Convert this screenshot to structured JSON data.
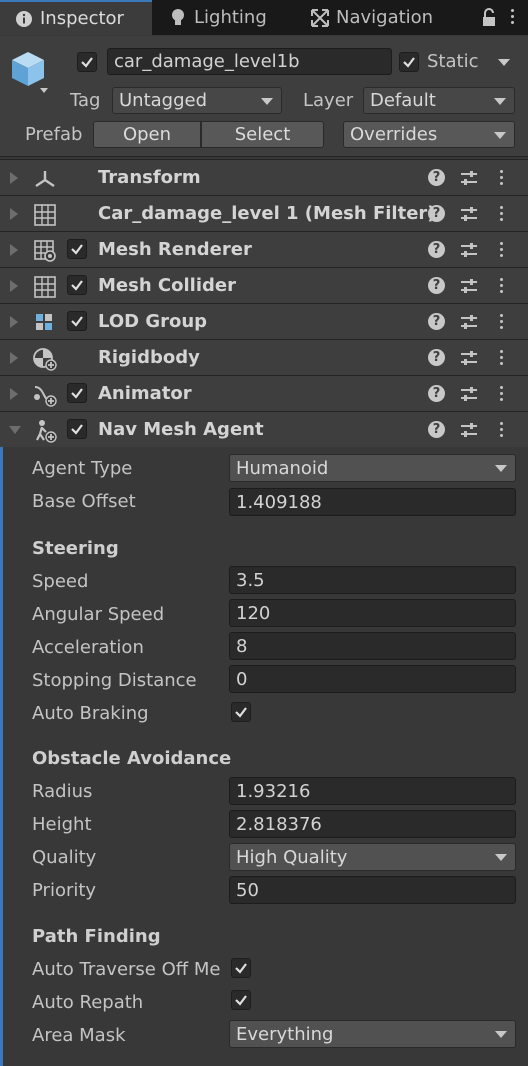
{
  "tabs": [
    {
      "label": "Inspector",
      "icon": "info-icon"
    },
    {
      "label": "Lighting",
      "icon": "bulb-icon"
    },
    {
      "label": "Navigation",
      "icon": "navigation-icon"
    }
  ],
  "header": {
    "object_name": "car_damage_level1b",
    "active": true,
    "static_label": "Static",
    "static_checked": true,
    "tag_label": "Tag",
    "tag_value": "Untagged",
    "layer_label": "Layer",
    "layer_value": "Default",
    "prefab_label": "Prefab",
    "open_label": "Open",
    "select_label": "Select",
    "overrides_label": "Overrides"
  },
  "components": [
    {
      "title": "Transform",
      "has_toggle": false,
      "icon": "transform-icon"
    },
    {
      "title": "Car_damage_level 1 (Mesh Filter)",
      "has_toggle": false,
      "icon": "mesh-filter-icon"
    },
    {
      "title": "Mesh Renderer",
      "has_toggle": true,
      "icon": "mesh-renderer-icon"
    },
    {
      "title": "Mesh Collider",
      "has_toggle": true,
      "icon": "mesh-collider-icon"
    },
    {
      "title": "LOD Group",
      "has_toggle": true,
      "icon": "lod-group-icon"
    },
    {
      "title": "Rigidbody",
      "has_toggle": false,
      "icon": "rigidbody-icon"
    },
    {
      "title": "Animator",
      "has_toggle": true,
      "icon": "animator-icon"
    },
    {
      "title": "Nav Mesh Agent",
      "has_toggle": true,
      "icon": "nav-mesh-agent-icon",
      "expanded": true
    }
  ],
  "nav_agent": {
    "agent_type_label": "Agent Type",
    "agent_type_value": "Humanoid",
    "base_offset_label": "Base Offset",
    "base_offset_value": "1.409188",
    "steering_header": "Steering",
    "speed_label": "Speed",
    "speed_value": "3.5",
    "angular_speed_label": "Angular Speed",
    "angular_speed_value": "120",
    "acceleration_label": "Acceleration",
    "acceleration_value": "8",
    "stopping_distance_label": "Stopping Distance",
    "stopping_distance_value": "0",
    "auto_braking_label": "Auto Braking",
    "auto_braking_checked": true,
    "obstacle_header": "Obstacle Avoidance",
    "radius_label": "Radius",
    "radius_value": "1.93216",
    "height_label": "Height",
    "height_value": "2.818376",
    "quality_label": "Quality",
    "quality_value": "High Quality",
    "priority_label": "Priority",
    "priority_value": "50",
    "path_header": "Path Finding",
    "auto_traverse_label": "Auto Traverse Off Me",
    "auto_traverse_checked": true,
    "auto_repath_label": "Auto Repath",
    "auto_repath_checked": true,
    "area_mask_label": "Area Mask",
    "area_mask_value": "Everything"
  },
  "colors": {
    "accent": "#3a79bb",
    "panel": "#383838",
    "header": "#3e3e3e",
    "field": "#2a2a2a"
  }
}
